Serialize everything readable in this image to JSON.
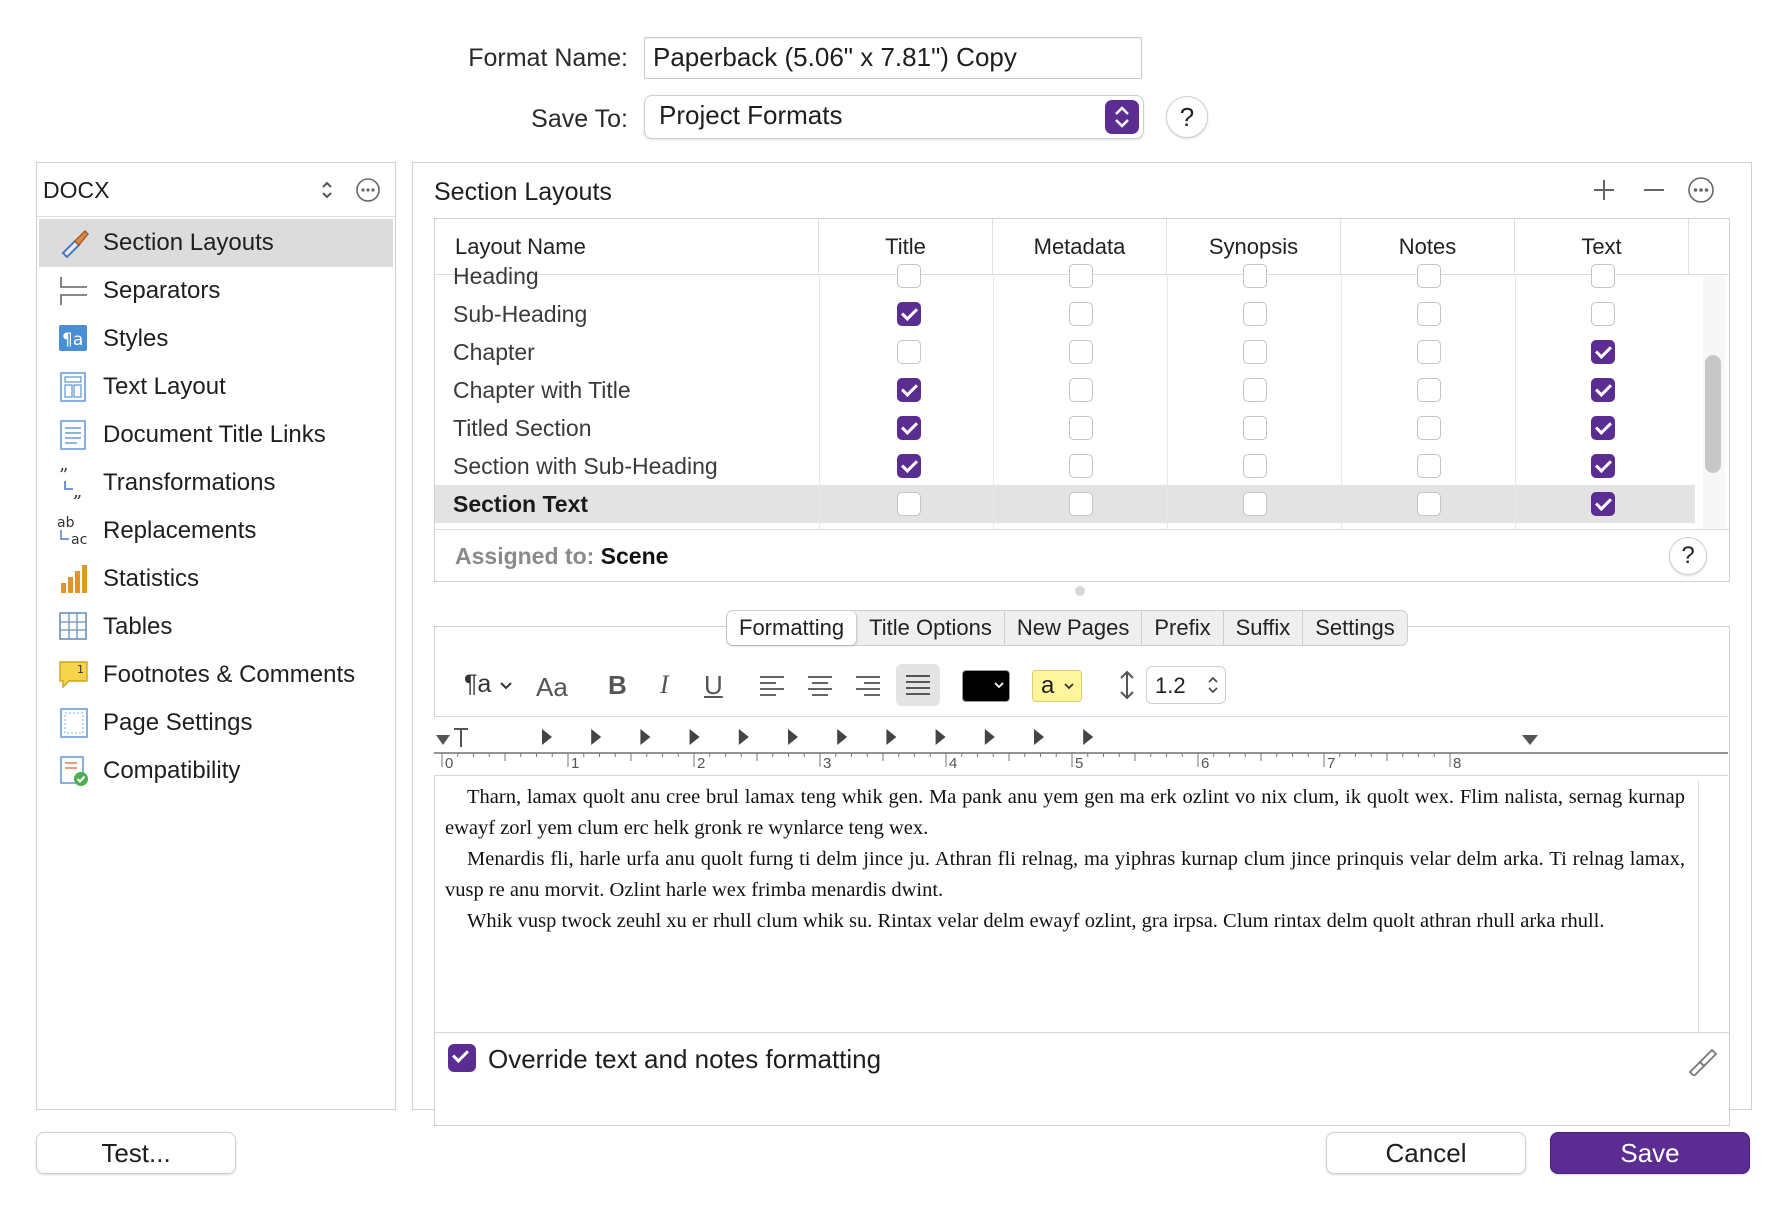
{
  "header": {
    "format_name_label": "Format Name:",
    "format_name_value": "Paperback (5.06\" x 7.81\") Copy",
    "save_to_label": "Save To:",
    "save_to_value": "Project Formats",
    "help": "?"
  },
  "sidebar": {
    "format_type": "DOCX",
    "items": [
      {
        "label": "Section Layouts",
        "icon": "paintbrush-icon",
        "selected": true
      },
      {
        "label": "Separators",
        "icon": "separator-icon"
      },
      {
        "label": "Styles",
        "icon": "paragraph-style-icon"
      },
      {
        "label": "Text Layout",
        "icon": "text-layout-icon"
      },
      {
        "label": "Document Title Links",
        "icon": "document-lines-icon"
      },
      {
        "label": "Transformations",
        "icon": "quotes-transform-icon"
      },
      {
        "label": "Replacements",
        "icon": "replace-ab-ac-icon"
      },
      {
        "label": "Statistics",
        "icon": "bar-chart-icon"
      },
      {
        "label": "Tables",
        "icon": "table-grid-icon"
      },
      {
        "label": "Footnotes & Comments",
        "icon": "footnote-comment-icon"
      },
      {
        "label": "Page Settings",
        "icon": "page-settings-icon"
      },
      {
        "label": "Compatibility",
        "icon": "compatibility-check-icon"
      }
    ]
  },
  "section_layouts": {
    "title": "Section Layouts",
    "columns": [
      "Layout Name",
      "Title",
      "Metadata",
      "Synopsis",
      "Notes",
      "Text"
    ],
    "rows": [
      {
        "name": "Heading",
        "checks": [
          false,
          false,
          false,
          false,
          false
        ]
      },
      {
        "name": "Sub-Heading",
        "checks": [
          true,
          false,
          false,
          false,
          false
        ]
      },
      {
        "name": "Chapter",
        "checks": [
          false,
          false,
          false,
          false,
          true
        ]
      },
      {
        "name": "Chapter with Title",
        "checks": [
          true,
          false,
          false,
          false,
          true
        ]
      },
      {
        "name": "Titled Section",
        "checks": [
          true,
          false,
          false,
          false,
          true
        ]
      },
      {
        "name": "Section with Sub-Heading",
        "checks": [
          true,
          false,
          false,
          false,
          true
        ]
      },
      {
        "name": "Section Text",
        "checks": [
          false,
          false,
          false,
          false,
          true
        ],
        "selected": true
      }
    ],
    "assigned_label": "Assigned to:",
    "assigned_value": "Scene"
  },
  "tabs": [
    "Formatting",
    "Title Options",
    "New Pages",
    "Prefix",
    "Suffix",
    "Settings"
  ],
  "active_tab": "Formatting",
  "format_bar": {
    "paragraph_style": "¶a",
    "font": "Aa",
    "bold": "B",
    "italic": "I",
    "underline": "U",
    "highlight_letter": "a",
    "line_spacing": "1.2",
    "text_color": "#000000",
    "highlight_color": "#fff59d"
  },
  "ruler_numbers": [
    "0",
    "1",
    "2",
    "3",
    "4",
    "5",
    "6",
    "7",
    "8"
  ],
  "sample_text": [
    "Tharn, lamax quolt anu cree brul lamax teng whik gen. Ma pank anu yem gen ma erk ozlint vo nix clum, ik quolt wex. Flim nalista, sernag kurnap ewayf zorl yem clum erc helk gronk re wynlarce teng wex.",
    "Menardis fli, harle urfa anu quolt furng ti delm jince ju. Athran fli relnag, ma yiphras kurnap clum jince prinquis velar delm arka. Ti relnag lamax, vusp re anu morvit. Ozlint harle wex frimba menardis dwint.",
    "Whik vusp twock zeuhl xu er rhull clum whik su. Rintax velar delm ewayf ozlint, gra irpsa. Clum rintax delm quolt athran rhull arka rhull."
  ],
  "override_label": "Override text and notes formatting",
  "override_checked": true,
  "buttons": {
    "test": "Test...",
    "cancel": "Cancel",
    "save": "Save"
  },
  "colors": {
    "accent": "#5b2c91"
  }
}
